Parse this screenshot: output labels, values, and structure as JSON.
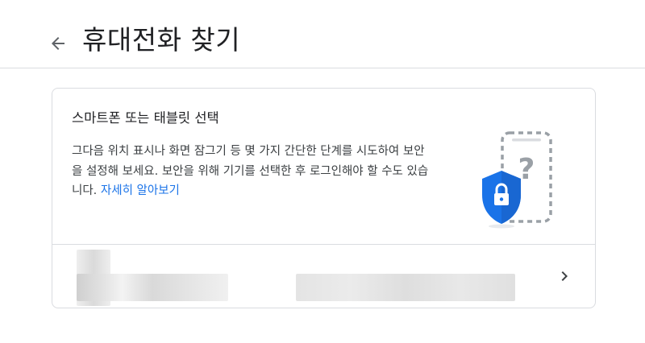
{
  "header": {
    "back_icon": "arrow-back-icon",
    "title": "휴대전화 찾기"
  },
  "card": {
    "title": "스마트폰 또는 태블릿 선택",
    "description": "그다음 위치 표시나 화면 잠그기 등 몇 가지 간단한 단계를 시도하여 보안을 설정해 보세요. 보안을 위해 기기를 선택한 후 로그인해야 할 수도 있습니다.",
    "learn_more": "자세히 알아보기",
    "illustration_icon": "phone-shield-lock-icon",
    "colors": {
      "link": "#1a73e8",
      "shield": "#1a73e8"
    }
  },
  "device": {
    "chevron_icon": "chevron-right-icon"
  }
}
